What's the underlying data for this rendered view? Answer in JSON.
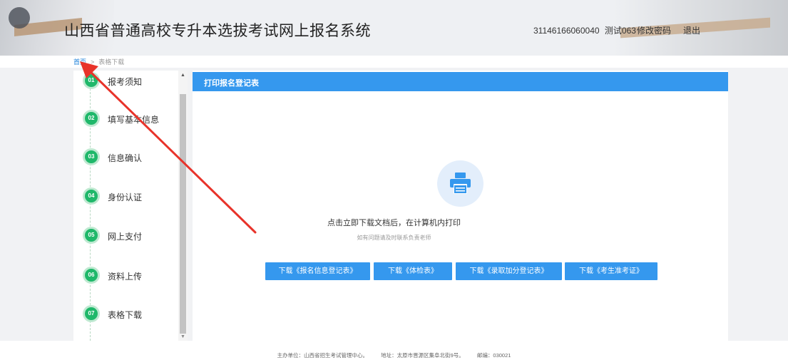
{
  "header": {
    "title": "山西省普通高校专升本选拔考试网上报名系统",
    "user_id": "31146166060040",
    "user_name": "测试063",
    "change_password": "修改密码",
    "logout": "退出"
  },
  "breadcrumb": {
    "home": "首页",
    "separator": ">",
    "current": "表格下载"
  },
  "sidebar": {
    "steps": [
      {
        "num": "01",
        "label": "报考须知"
      },
      {
        "num": "02",
        "label": "填写基本信息"
      },
      {
        "num": "03",
        "label": "信息确认"
      },
      {
        "num": "04",
        "label": "身份认证"
      },
      {
        "num": "05",
        "label": "网上支付"
      },
      {
        "num": "06",
        "label": "资料上传"
      },
      {
        "num": "07",
        "label": "表格下载"
      }
    ]
  },
  "panel": {
    "title": "打印报名登记表",
    "icon": "printer-icon",
    "main_message": "点击立即下载文档后，在计算机内打印",
    "sub_message": "如有问题请及时联系负责老师",
    "buttons": [
      {
        "label": "下载《报名信息登记表》"
      },
      {
        "label": "下载《体检表》"
      },
      {
        "label": "下载《录取加分登记表》"
      },
      {
        "label": "下载《考生准考证》"
      }
    ]
  },
  "footer": {
    "organizer": "主办单位：山西省招生考试管理中心。",
    "address": "地址：太原市晋源区集阜北街9号。",
    "postcode": "邮编：030021"
  },
  "colors": {
    "accent": "#3598ee",
    "step_badge": "#1fb86a",
    "annotation_arrow": "#e8332a"
  }
}
